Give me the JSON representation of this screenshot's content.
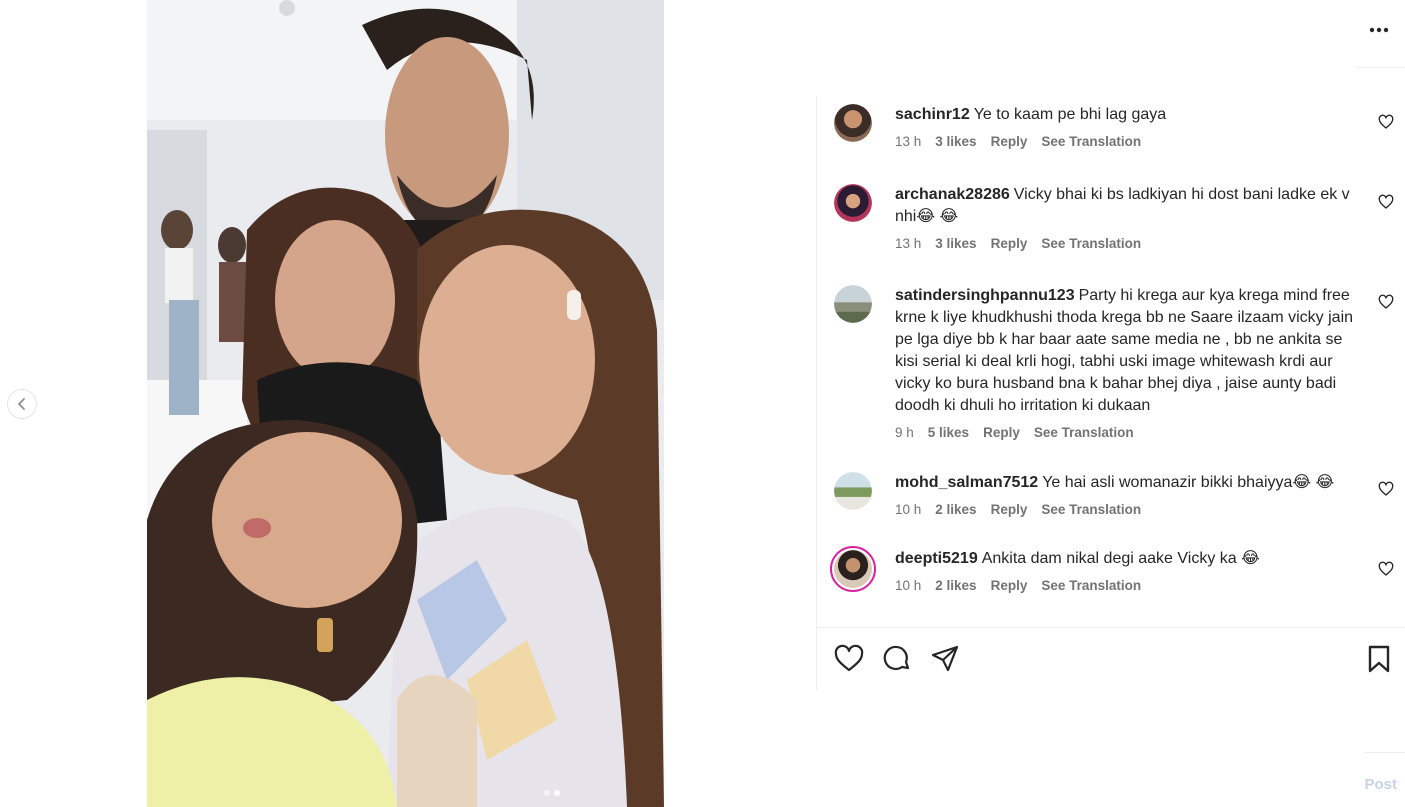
{
  "post": {
    "carousel": {
      "prev_icon": "chevron-left-icon",
      "slide_count": 2,
      "active_slide": 2
    }
  },
  "panel": {
    "more_icon": "more-horizontal-icon",
    "comments": [
      {
        "username": "sachinr12",
        "text": "Ye to kaam pe bhi lag gaya",
        "time": "13 h",
        "likes": "3 likes",
        "reply": "Reply",
        "translate": "See Translation"
      },
      {
        "username": "archanak28286",
        "text": "Vicky bhai ki bs ladkiyan hi dost bani ladke ek v nhi😂 😂",
        "time": "13 h",
        "likes": "3 likes",
        "reply": "Reply",
        "translate": "See Translation"
      },
      {
        "username": "satindersinghpannu123",
        "text": "Party hi krega aur kya krega mind free krne k liye khudkhushi thoda krega bb ne Saare ilzaam vicky jain pe lga diye bb k har baar aate same media ne , bb ne ankita se kisi serial ki deal krli hogi, tabhi uski image whitewash krdi aur vicky ko bura husband bna k bahar bhej diya , jaise aunty badi doodh ki dhuli ho irritation ki dukaan",
        "time": "9 h",
        "likes": "5 likes",
        "reply": "Reply",
        "translate": "See Translation"
      },
      {
        "username": "mohd_salman7512",
        "text": "Ye hai asli womanazir bikki bhaiyya😂 😂",
        "time": "10 h",
        "likes": "2 likes",
        "reply": "Reply",
        "translate": "See Translation"
      },
      {
        "username": "deepti5219",
        "text": "Ankita dam nikal degi aake Vicky ka 😂",
        "time": "10 h",
        "likes": "2 likes",
        "reply": "Reply",
        "translate": "See Translation"
      }
    ],
    "actions": {
      "like_icon": "heart-icon",
      "comment_icon": "comment-icon",
      "share_icon": "share-icon",
      "save_icon": "bookmark-icon"
    },
    "ghost_text": "Post"
  },
  "colors": {
    "text": "#262626",
    "secondary": "#737373",
    "divider": "#efefef",
    "story_ring": "#d6249f"
  }
}
